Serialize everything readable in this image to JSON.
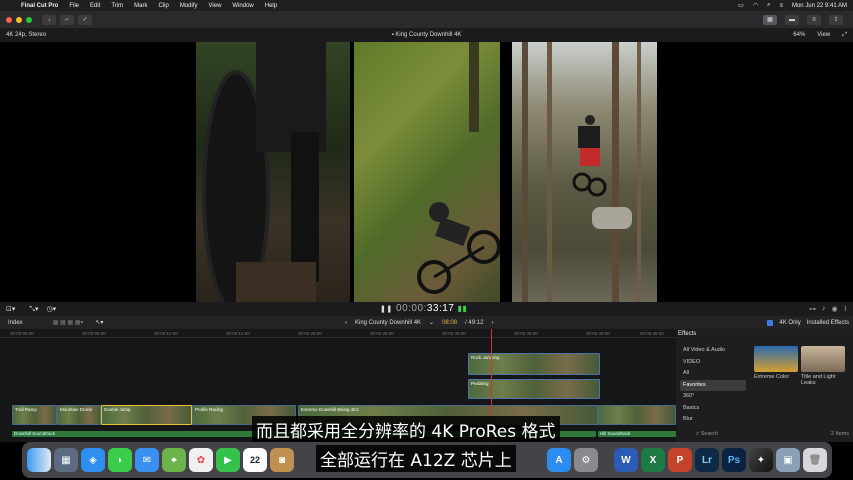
{
  "menubar": {
    "app": "Final Cut Pro",
    "items": [
      "File",
      "Edit",
      "Trim",
      "Mark",
      "Clip",
      "Modify",
      "View",
      "Window",
      "Help"
    ],
    "clock": "Mon Jun 22  9:41 AM"
  },
  "viewer": {
    "format": "4K 24p, Stereo",
    "title": "King County Downhill 4K",
    "zoom": "64%",
    "view_label": "View",
    "timecode_dim": "00:00:",
    "timecode": "33:17"
  },
  "timeline_header": {
    "index_label": "Index",
    "project": "King County Downhill 4K",
    "timecode": "08:08",
    "duration": "/ 49:12"
  },
  "ruler": [
    "00:00:00:00",
    "00:00:05:00",
    "00:00:10:00",
    "00:00:15:00",
    "00:00:20:00",
    "00:00:25:00",
    "00:00:30:00",
    "00:00:35:00",
    "00:00:40:00",
    "00:00:45:00"
  ],
  "clips": {
    "trail_ramp": "Trail Ramp",
    "mountain_drone": "Mountain Drone",
    "double_jump": "Double Jump",
    "profile_racing": "Profile Racing",
    "extreme_downhill": "Extreme Downhill Biking 4K2",
    "rock_jumping": "Rock Jumping",
    "pedaling": "Pedaling",
    "audio1": "Downhill Soundtrack",
    "audio2": "Hill Soundtrack"
  },
  "effects": {
    "title": "Effects",
    "filter_4k": "4K Only",
    "installed": "Installed Effects",
    "categories": [
      "All Video & Audio",
      "VIDEO",
      "All",
      "Favorites",
      "360°",
      "Basics",
      "Blur"
    ],
    "items": [
      "Extreme Color",
      "Title and Light Leaks"
    ],
    "search_placeholder": "Search",
    "count": "2 Items"
  },
  "subtitles": {
    "line1": "而且都采用全分辨率的 4K ProRes 格式",
    "line2": "全部运行在 A12Z 芯片上"
  },
  "dock_icons": [
    "finder-icon",
    "launchpad-icon",
    "safari-icon",
    "messages-icon",
    "mail-icon",
    "maps-icon",
    "photos-icon",
    "facetime-icon",
    "calendar-icon",
    "contacts-icon",
    "appstore-icon",
    "system-preferences-icon",
    "word-icon",
    "excel-icon",
    "powerpoint-icon",
    "lightroom-icon",
    "photoshop-icon",
    "final-cut-pro-icon",
    "preview-icon",
    "trash-icon"
  ],
  "dock": {
    "calendar_day": "22",
    "word": "W",
    "excel": "X",
    "ppt": "P",
    "lr": "Lr",
    "ps": "Ps"
  },
  "colors": {
    "accent_timecode": "#e8b84a",
    "playhead": "#d8322f",
    "selection": "#e8c23a",
    "audio": "#2f7a3a"
  }
}
